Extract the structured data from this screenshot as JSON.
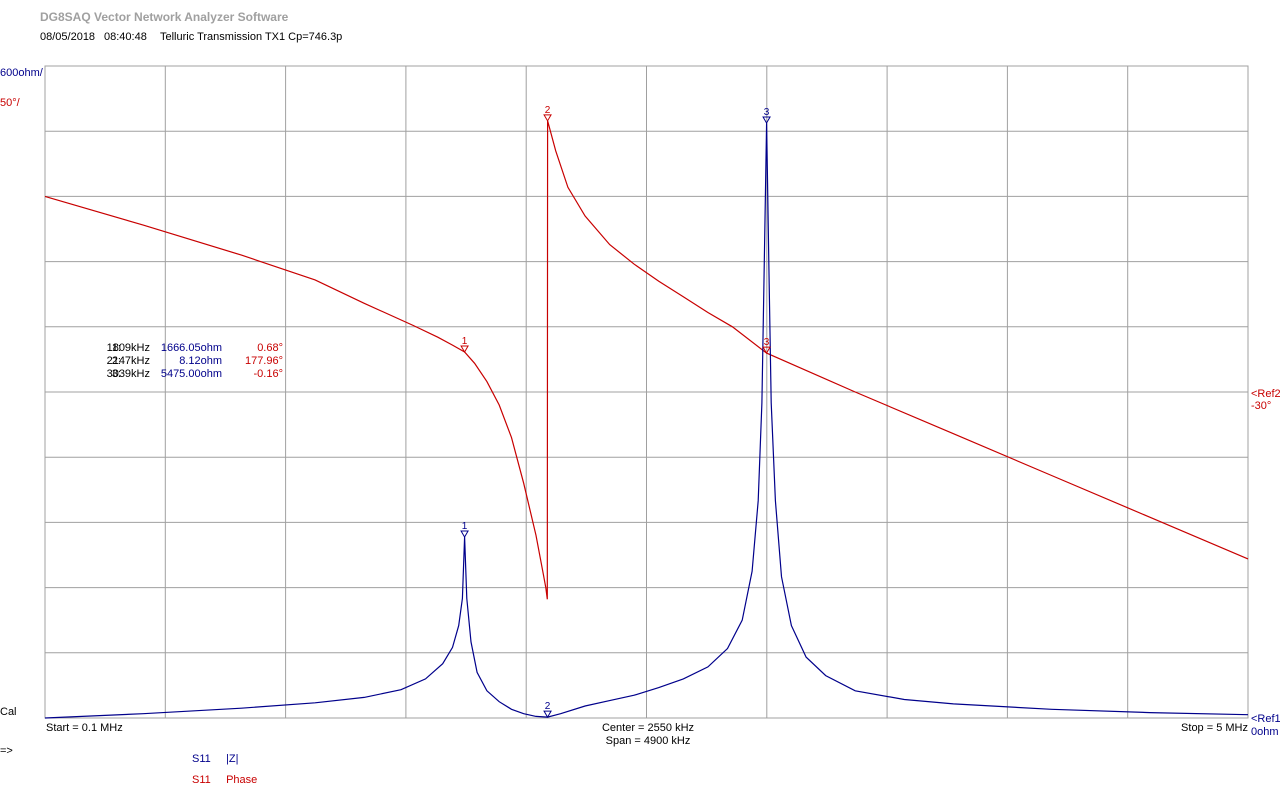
{
  "app": {
    "title": "DG8SAQ Vector Network Analyzer Software",
    "date": "08/05/2018",
    "time": "08:40:48",
    "measurement_title": "Telluric Transmission TX1 Cp=746.3p"
  },
  "colors": {
    "magnitude": "#00008b",
    "phase": "#c80000",
    "grid": "#a0a0a0",
    "title": "#a0a0a0",
    "background": "#ffffff"
  },
  "axis": {
    "magnitude_scale": "600ohm/",
    "phase_scale": "50°/",
    "ref2_label": "<Ref2",
    "ref2_value": "-30°",
    "ref1_label": "<Ref1",
    "ref1_value": "0ohm",
    "start": "Start = 0.1 MHz",
    "center": "Center = 2550 kHz",
    "span": "Span = 4900 kHz",
    "stop": "Stop = 5 MHz"
  },
  "status": {
    "cal": "Cal",
    "prompt": "=>"
  },
  "legend": [
    {
      "port": "S11",
      "name": "|Z|",
      "color": "#00008b"
    },
    {
      "port": "S11",
      "name": "Phase",
      "color": "#c80000"
    }
  ],
  "markers": [
    {
      "id": "1:",
      "freq": "1809kHz",
      "magnitude": "1666.05ohm",
      "phase": "0.68°",
      "label": "1"
    },
    {
      "id": "2:",
      "freq": "2147kHz",
      "magnitude": "8.12ohm",
      "phase": "177.96°",
      "label": "2"
    },
    {
      "id": "3:",
      "freq": "3039kHz",
      "magnitude": "5475.00ohm",
      "phase": "-0.16°",
      "label": "3"
    }
  ],
  "chart_data": {
    "type": "line",
    "xlabel": "",
    "ylabel": "",
    "x_unit": "kHz",
    "xlim": [
      100,
      5000
    ],
    "ylim_magnitude": [
      0,
      6000
    ],
    "ylim_phase": [
      -280,
      220
    ],
    "grid": true,
    "series": [
      {
        "name": "S11 |Z|",
        "axis": "magnitude",
        "x": [
          100,
          500,
          900,
          1200,
          1400,
          1550,
          1650,
          1720,
          1760,
          1785,
          1800,
          1809,
          1818,
          1835,
          1860,
          1900,
          1950,
          2000,
          2050,
          2100,
          2147,
          2200,
          2300,
          2400,
          2500,
          2600,
          2700,
          2800,
          2880,
          2940,
          2980,
          3005,
          3020,
          3030,
          3039,
          3048,
          3058,
          3075,
          3100,
          3140,
          3200,
          3280,
          3400,
          3600,
          3800,
          4200,
          4600,
          5000
        ],
        "y": [
          0,
          40,
          90,
          140,
          190,
          260,
          360,
          500,
          650,
          850,
          1100,
          1666,
          1100,
          700,
          420,
          250,
          150,
          80,
          40,
          15,
          8,
          40,
          110,
          160,
          210,
          280,
          360,
          470,
          640,
          900,
          1350,
          2000,
          2900,
          4200,
          5475,
          4200,
          2900,
          2000,
          1300,
          850,
          560,
          390,
          250,
          170,
          130,
          80,
          50,
          30
        ]
      },
      {
        "name": "S11 Phase",
        "axis": "phase",
        "x": [
          100,
          500,
          900,
          1200,
          1400,
          1600,
          1700,
          1760,
          1809,
          1850,
          1900,
          1950,
          2000,
          2050,
          2100,
          2130,
          2140,
          2146,
          2147,
          2180,
          2230,
          2300,
          2400,
          2500,
          2600,
          2700,
          2800,
          2900,
          3039,
          3400,
          3800,
          4200,
          4600,
          5000
        ],
        "y": [
          120,
          98,
          75,
          56,
          38,
          21,
          12,
          6,
          0.68,
          -8,
          -22,
          -40,
          -65,
          -100,
          -140,
          -170,
          -180,
          -189,
          177.96,
          155,
          127,
          105,
          83,
          68,
          55,
          43,
          31,
          20,
          -0.16,
          -30,
          -62,
          -94,
          -126,
          -158
        ]
      }
    ]
  }
}
